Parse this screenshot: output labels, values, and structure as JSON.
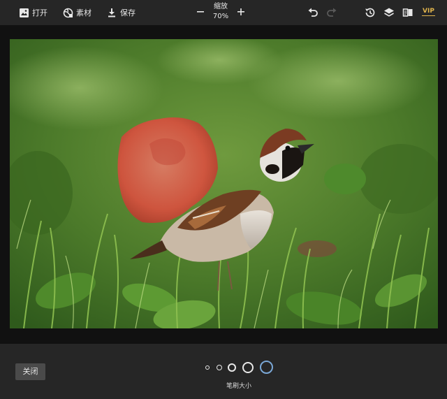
{
  "toolbar": {
    "open_label": "打开",
    "material_label": "素材",
    "save_label": "保存",
    "zoom_label": "缩放",
    "zoom_value": "70%",
    "vip_label": "VIP",
    "icons": [
      "image-icon",
      "globe-icon",
      "download-icon",
      "minus-icon",
      "plus-icon",
      "undo-icon",
      "redo-icon",
      "history-icon",
      "layers-icon",
      "compare-icon"
    ]
  },
  "footer": {
    "close_label": "关闭",
    "brush_size_label": "笔刷大小",
    "brush_sizes_count": 5,
    "selected_brush_index": 4,
    "accent_color": "#7aa7d6"
  },
  "canvas": {
    "subject": "sparrow-on-grass-photo",
    "mask_color": "#d8503f"
  }
}
